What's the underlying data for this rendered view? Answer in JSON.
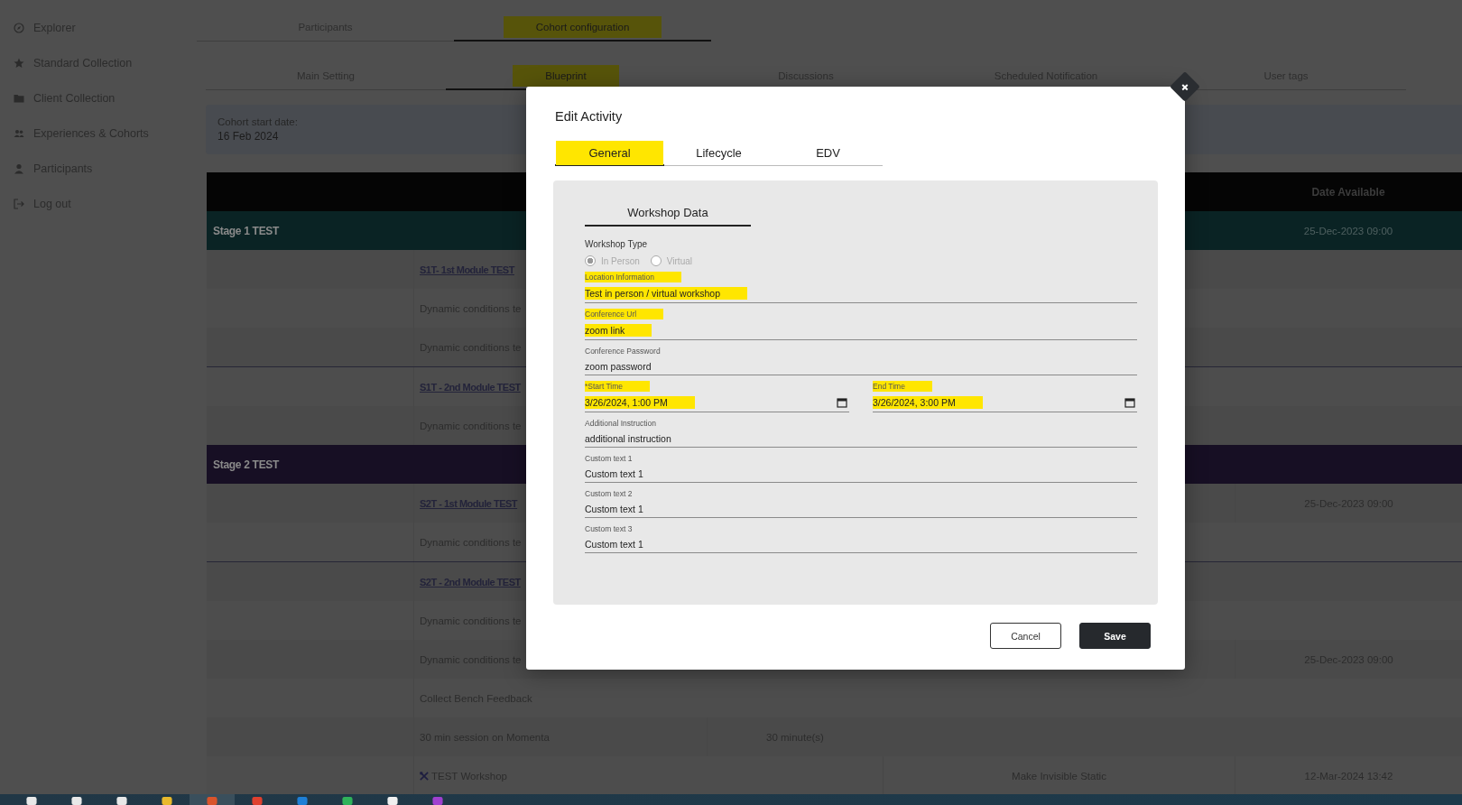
{
  "sidebar": {
    "items": [
      {
        "label": "Explorer"
      },
      {
        "label": "Standard Collection"
      },
      {
        "label": "Client Collection"
      },
      {
        "label": "Experiences & Cohorts"
      },
      {
        "label": "Participants"
      },
      {
        "label": "Log out"
      }
    ]
  },
  "top_tabs": [
    {
      "label": "Participants",
      "selected": false,
      "highlighted": false
    },
    {
      "label": "Cohort configuration",
      "selected": true,
      "highlighted": true
    }
  ],
  "sub_tabs": [
    {
      "label": "Main Setting",
      "selected": false,
      "highlighted": false
    },
    {
      "label": "Blueprint",
      "selected": true,
      "highlighted": true
    },
    {
      "label": "Discussions",
      "selected": false,
      "highlighted": false
    },
    {
      "label": "Scheduled Notification",
      "selected": false,
      "highlighted": false
    },
    {
      "label": "User tags",
      "selected": false,
      "highlighted": false
    }
  ],
  "cohort_info": {
    "label": "Cohort start date:",
    "value": "16 Feb 2024"
  },
  "table": {
    "header": "Date Available",
    "rows": [
      {
        "kind": "stage",
        "label": "Stage 1 TEST",
        "color": "#0a2324",
        "date": "25-Dec-2023 09:00"
      },
      {
        "kind": "activity",
        "name": "S1T- 1st Module TEST",
        "link": true,
        "divider_above": false
      },
      {
        "kind": "activity",
        "name": "Dynamic conditions te",
        "link": false,
        "divider_above": false
      },
      {
        "kind": "activity",
        "name": "Dynamic conditions te",
        "link": false,
        "divider_above": false
      },
      {
        "kind": "activity",
        "name": "S1T - 2nd Module TEST",
        "link": true,
        "divider_above": true
      },
      {
        "kind": "activity",
        "name": "Dynamic conditions te",
        "link": false,
        "divider_above": false
      },
      {
        "kind": "stage",
        "label": "Stage 2 TEST",
        "color": "#170f24"
      },
      {
        "kind": "activity",
        "name": "S2T - 1st Module TEST",
        "link": true,
        "divider_above": false,
        "date": "25-Dec-2023 09:00"
      },
      {
        "kind": "activity",
        "name": "Dynamic conditions te",
        "link": false,
        "divider_above": false
      },
      {
        "kind": "activity",
        "name": "S2T - 2nd Module TEST",
        "link": true,
        "divider_above": true
      },
      {
        "kind": "activity",
        "name": "Dynamic conditions te",
        "link": false,
        "divider_above": false
      },
      {
        "kind": "activity",
        "name": "Dynamic conditions te",
        "link": false,
        "divider_above": false,
        "date": "25-Dec-2023 09:00"
      },
      {
        "kind": "activity",
        "name": "Collect Bench Feedback",
        "link": false,
        "divider_above": false
      },
      {
        "kind": "activity",
        "name": "30 min session on Momenta",
        "link": false,
        "divider_above": false,
        "duration": "30 minute(s)"
      },
      {
        "kind": "workshop",
        "name": "TEST Workshop",
        "link": false,
        "divider_above": false,
        "status": "Make Invisible Static",
        "date": "12-Mar-2024 13:42"
      }
    ]
  },
  "modal": {
    "title": "Edit Activity",
    "tabs": [
      {
        "label": "General",
        "selected": true,
        "highlighted": true
      },
      {
        "label": "Lifecycle",
        "selected": false,
        "highlighted": false
      },
      {
        "label": "EDV",
        "selected": false,
        "highlighted": false
      }
    ],
    "section_tab": "Workshop Data",
    "workshop_type": {
      "label": "Workshop Type",
      "disabled": true,
      "options": [
        {
          "label": "In Person",
          "selected": true
        },
        {
          "label": "Virtual",
          "selected": false
        }
      ]
    },
    "fields": [
      {
        "kind": "text",
        "label": "Location Information",
        "value": "Test in person / virtual workshop",
        "highlighted": true
      },
      {
        "kind": "text",
        "label": "Conference Url",
        "value": "zoom link",
        "highlighted": true
      },
      {
        "kind": "text",
        "label": "Conference Password",
        "value": "zoom password",
        "highlighted": false
      },
      {
        "kind": "date",
        "label": "Start Time",
        "required_mark": "*",
        "value": "3/26/2024, 1:00 PM",
        "highlighted": true
      },
      {
        "kind": "date",
        "label": "End Time",
        "value": "3/26/2024, 3:00 PM",
        "highlighted": true
      },
      {
        "kind": "text",
        "label": "Additional Instruction",
        "value": "additional instruction",
        "highlighted": false
      },
      {
        "kind": "text",
        "label": "Custom text 1",
        "value": "Custom text 1",
        "highlighted": false
      },
      {
        "kind": "text",
        "label": "Custom text 2",
        "value": "Custom text 1",
        "highlighted": false
      },
      {
        "kind": "text",
        "label": "Custom text 3",
        "value": "Custom text 1",
        "highlighted": false
      }
    ],
    "buttons": [
      {
        "label": "Cancel",
        "kind": "secondary"
      },
      {
        "label": "Save",
        "kind": "primary"
      }
    ]
  }
}
